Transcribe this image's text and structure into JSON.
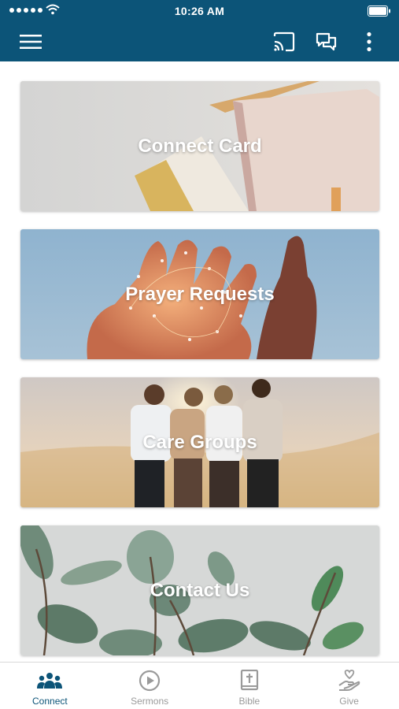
{
  "status_bar": {
    "time": "10:26 AM"
  },
  "app_bar": {
    "menu_icon": "hamburger-menu-icon",
    "cast_icon": "cast-icon",
    "chat_icon": "chat-icon",
    "more_icon": "more-vertical-icon"
  },
  "cards": [
    {
      "label": "Connect Card",
      "image": "notebook-and-sticky-notes"
    },
    {
      "label": "Prayer Requests",
      "image": "hands-with-string-lights"
    },
    {
      "label": "Care Groups",
      "image": "friends-embracing-at-sunset"
    },
    {
      "label": "Contact Us",
      "image": "green-plant-leaves"
    }
  ],
  "tabs": [
    {
      "label": "Connect",
      "icon": "people-group-icon",
      "active": true
    },
    {
      "label": "Sermons",
      "icon": "play-circle-icon",
      "active": false
    },
    {
      "label": "Bible",
      "icon": "bible-book-icon",
      "active": false
    },
    {
      "label": "Give",
      "icon": "hand-heart-icon",
      "active": false
    }
  ],
  "colors": {
    "primary": "#0c5478",
    "tab_inactive": "#9a9a9a",
    "background": "#ffffff"
  }
}
